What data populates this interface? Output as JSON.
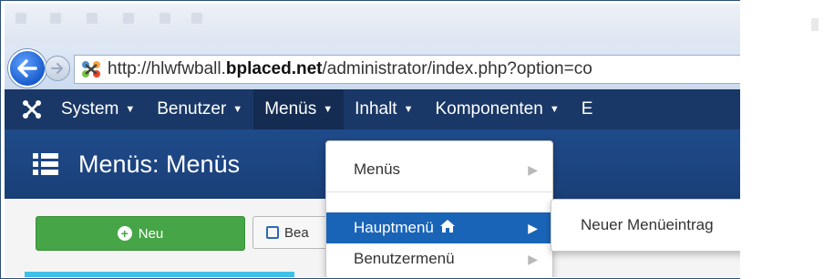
{
  "browser": {
    "url_prefix": "http://hlwfwball.",
    "url_domain": "bplaced.net",
    "url_suffix": "/administrator/index.php?option=co",
    "icons": [
      "back-arrow-icon",
      "forward-arrow-icon",
      "joomla-favicon-icon"
    ]
  },
  "navbar": {
    "items": [
      {
        "label": "System"
      },
      {
        "label": "Benutzer"
      },
      {
        "label": "Menüs"
      },
      {
        "label": "Inhalt"
      },
      {
        "label": "Komponenten"
      },
      {
        "label": "E"
      }
    ],
    "active_index": 2,
    "colors": {
      "bg": "#1a3867",
      "active_bg": "#142c52"
    }
  },
  "titlebar": {
    "title": "Menüs: Menüs",
    "icon": "list-icon"
  },
  "toolbar": {
    "new_label": "Neu",
    "edit_label": "Bea",
    "colors": {
      "new_bg": "#46a546"
    }
  },
  "dropdown": {
    "items": [
      {
        "label": "Menüs"
      },
      {
        "label": "Hauptmenü"
      },
      {
        "label": "Benutzermenü"
      }
    ],
    "highlighted": "Hauptmenü",
    "highlight_color": "#1a64b8"
  },
  "submenu": {
    "items": [
      {
        "label": "Neuer Menüeintrag"
      }
    ]
  }
}
